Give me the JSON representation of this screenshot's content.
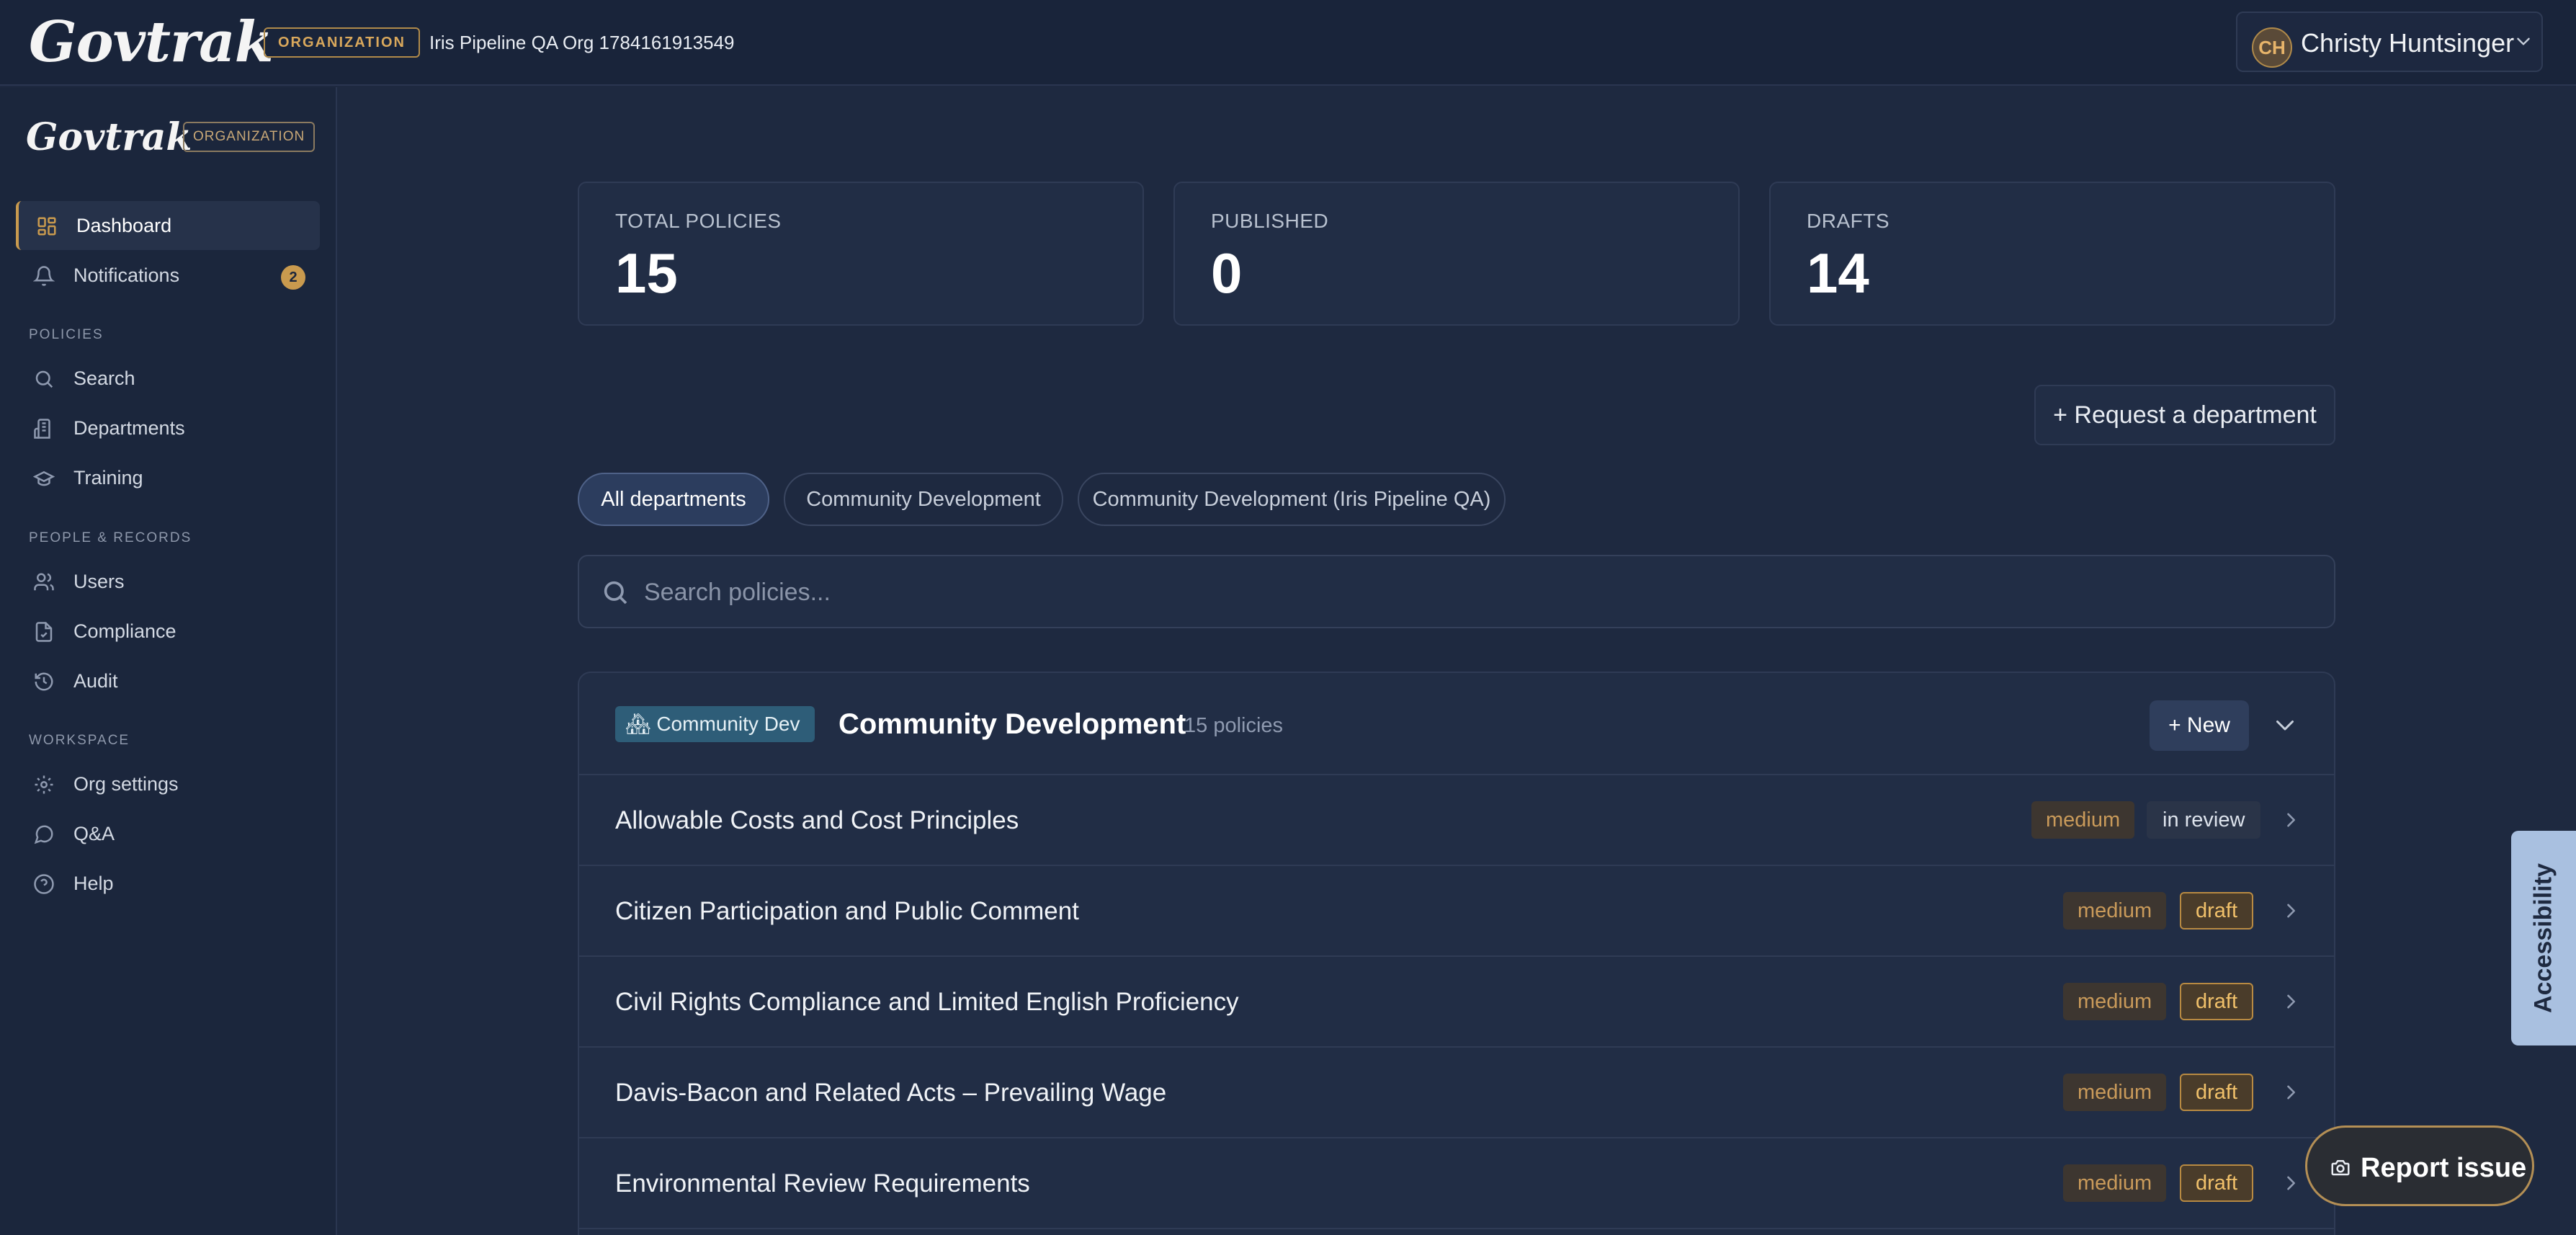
{
  "topbar": {
    "brand": "Govtrak",
    "org_badge": "ORGANIZATION",
    "org_name": "Iris Pipeline QA Org 1784161913549",
    "user": {
      "initials": "CH",
      "name": "Christy Huntsinger"
    }
  },
  "sidebar": {
    "brand": "Govtrak",
    "badge": "ORGANIZATION",
    "items": [
      {
        "label": "Dashboard",
        "icon": "dashboard-icon",
        "active": true
      },
      {
        "label": "Notifications",
        "icon": "bell-icon",
        "badge": "2"
      }
    ],
    "sections": [
      {
        "title": "POLICIES",
        "items": [
          {
            "label": "Search",
            "icon": "search-icon"
          },
          {
            "label": "Departments",
            "icon": "building-icon"
          },
          {
            "label": "Training",
            "icon": "graduation-cap-icon"
          }
        ]
      },
      {
        "title": "PEOPLE & RECORDS",
        "items": [
          {
            "label": "Users",
            "icon": "users-icon"
          },
          {
            "label": "Compliance",
            "icon": "clipboard-check-icon"
          },
          {
            "label": "Audit",
            "icon": "history-icon"
          }
        ]
      },
      {
        "title": "WORKSPACE",
        "items": [
          {
            "label": "Org settings",
            "icon": "gear-icon"
          },
          {
            "label": "Q&A",
            "icon": "chat-bubble-icon"
          },
          {
            "label": "Help",
            "icon": "help-circle-icon"
          }
        ]
      }
    ]
  },
  "stats": [
    {
      "label": "TOTAL POLICIES",
      "value": "15"
    },
    {
      "label": "PUBLISHED",
      "value": "0"
    },
    {
      "label": "DRAFTS",
      "value": "14"
    }
  ],
  "request_button": "+ Request a department",
  "filters": [
    "All departments",
    "Community Development",
    "Community Development (Iris Pipeline QA)"
  ],
  "search": {
    "placeholder": "Search policies..."
  },
  "department": {
    "tag": "Community Dev",
    "tag_emoji": "🏘",
    "title": "Community Development",
    "count": "15 policies",
    "new_button": "+ New",
    "policies": [
      {
        "title": "Allowable Costs and Cost Principles",
        "priority": "medium",
        "status": "in review"
      },
      {
        "title": "Citizen Participation and Public Comment",
        "priority": "medium",
        "status": "draft"
      },
      {
        "title": "Civil Rights Compliance and Limited English Proficiency",
        "priority": "medium",
        "status": "draft"
      },
      {
        "title": "Davis-Bacon and Related Acts – Prevailing Wage",
        "priority": "medium",
        "status": "draft"
      },
      {
        "title": "Environmental Review Requirements",
        "priority": "medium",
        "status": "draft"
      }
    ]
  },
  "accessibility_tab": "Accessibility",
  "report_issue": "Report issue",
  "colors": {
    "background": "#1e2940",
    "accent": "#c99a4e",
    "draft": "#f0c06a",
    "tag": "#2e5d78"
  }
}
